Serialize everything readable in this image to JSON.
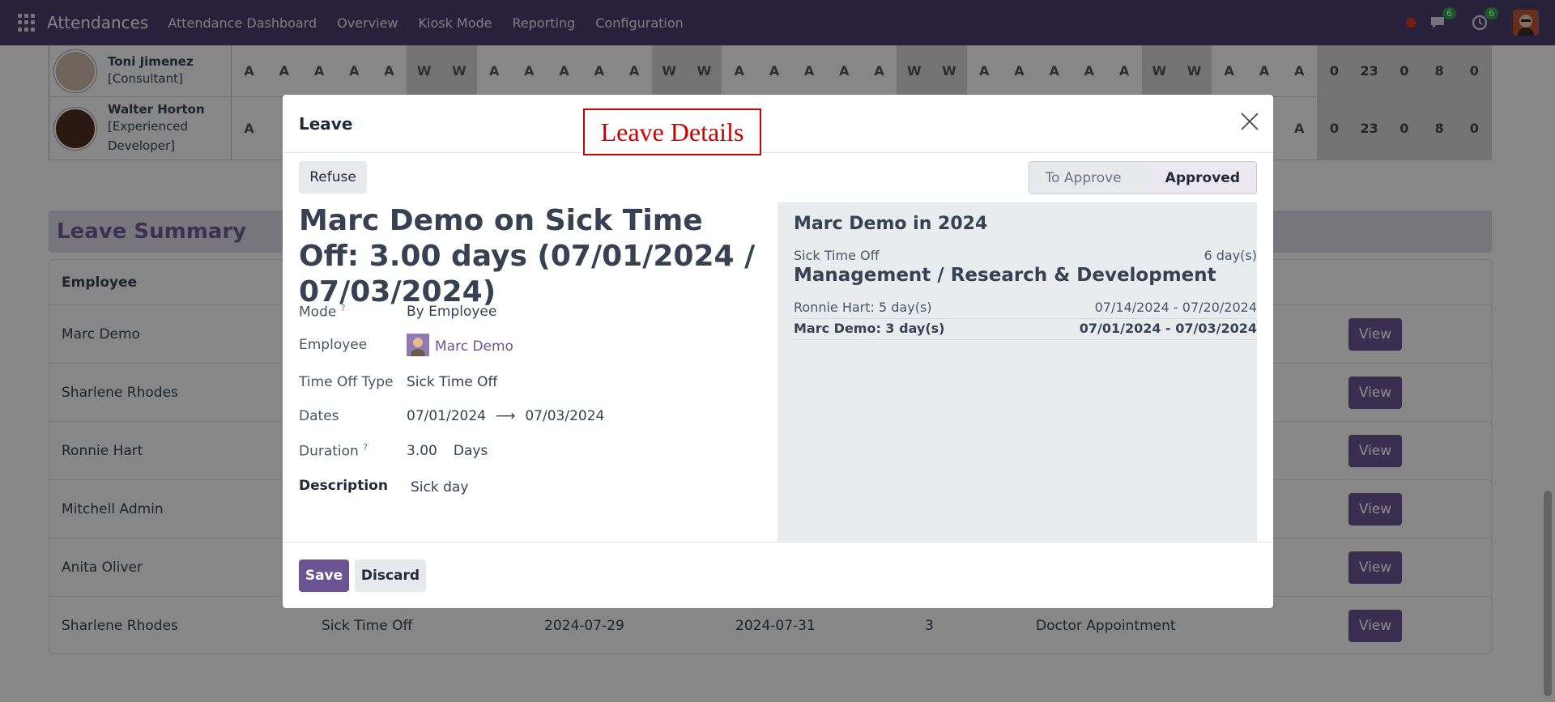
{
  "navbar": {
    "app_name": "Attendances",
    "menu": [
      "Attendance Dashboard",
      "Overview",
      "Kiosk Mode",
      "Reporting",
      "Configuration"
    ],
    "chat_count": "6",
    "activity_count": "6"
  },
  "attendance_rows": [
    {
      "name": "Toni Jimenez",
      "role": "[Consultant]",
      "cells": [
        "A",
        "A",
        "A",
        "A",
        "A",
        "W",
        "W",
        "A",
        "A",
        "A",
        "A",
        "A",
        "W",
        "W",
        "A",
        "A",
        "A",
        "A",
        "A",
        "W",
        "W",
        "A",
        "A",
        "A",
        "A",
        "A",
        "W",
        "W",
        "A",
        "A",
        "A"
      ],
      "totals": [
        "0",
        "23",
        "0",
        "8",
        "0"
      ]
    },
    {
      "name": "Walter Horton",
      "role_line1": "[Experienced",
      "role_line2": "Developer]",
      "cells_left": [
        "A"
      ],
      "cells_right": [
        "A",
        "A"
      ],
      "totals": [
        "0",
        "23",
        "0",
        "8",
        "0"
      ]
    }
  ],
  "leave_summary": {
    "title": "Leave Summary",
    "column_employee": "Employee",
    "view_label": "View",
    "rows": [
      {
        "employee": "Marc Demo"
      },
      {
        "employee": "Sharlene Rhodes"
      },
      {
        "employee": "Ronnie Hart"
      },
      {
        "employee": "Mitchell Admin"
      },
      {
        "employee": "Anita Oliver"
      },
      {
        "employee": "Sharlene Rhodes",
        "type": "Sick Time Off",
        "from": "2024-07-29",
        "to": "2024-07-31",
        "days": "3",
        "reason": "Doctor Appointment"
      }
    ]
  },
  "modal": {
    "title": "Leave",
    "annotation": "Leave Details",
    "refuse_label": "Refuse",
    "stages": {
      "todo": "To Approve",
      "active": "Approved"
    },
    "record_title": "Marc Demo on Sick Time Off: 3.00 days (07/01/2024 / 07/03/2024)",
    "fields": {
      "mode_label": "Mode",
      "mode_value": "By Employee",
      "employee_label": "Employee",
      "employee_value": "Marc Demo",
      "type_label": "Time Off Type",
      "type_value": "Sick Time Off",
      "dates_label": "Dates",
      "date_from": "07/01/2024",
      "date_to": "07/03/2024",
      "duration_label": "Duration",
      "duration_value": "3.00",
      "duration_unit": "Days",
      "description_label": "Description",
      "description_value": "Sick day",
      "help_mark": "?",
      "arrow": "⟶"
    },
    "side_panel": {
      "year_title": "Marc Demo in 2024",
      "sick_label": "Sick Time Off",
      "sick_value": "6 day(s)",
      "dept_title": "Management / Research & Development",
      "entries": [
        {
          "who": "Ronnie Hart: 5 day(s)",
          "range": "07/14/2024 - 07/20/2024"
        },
        {
          "who": "Marc Demo: 3 day(s)",
          "range": "07/01/2024 - 07/03/2024"
        }
      ]
    },
    "save_label": "Save",
    "discard_label": "Discard"
  },
  "colors": {
    "navbar": "#4a3d6e",
    "primary": "#6a5493",
    "annotation": "#d00000"
  }
}
